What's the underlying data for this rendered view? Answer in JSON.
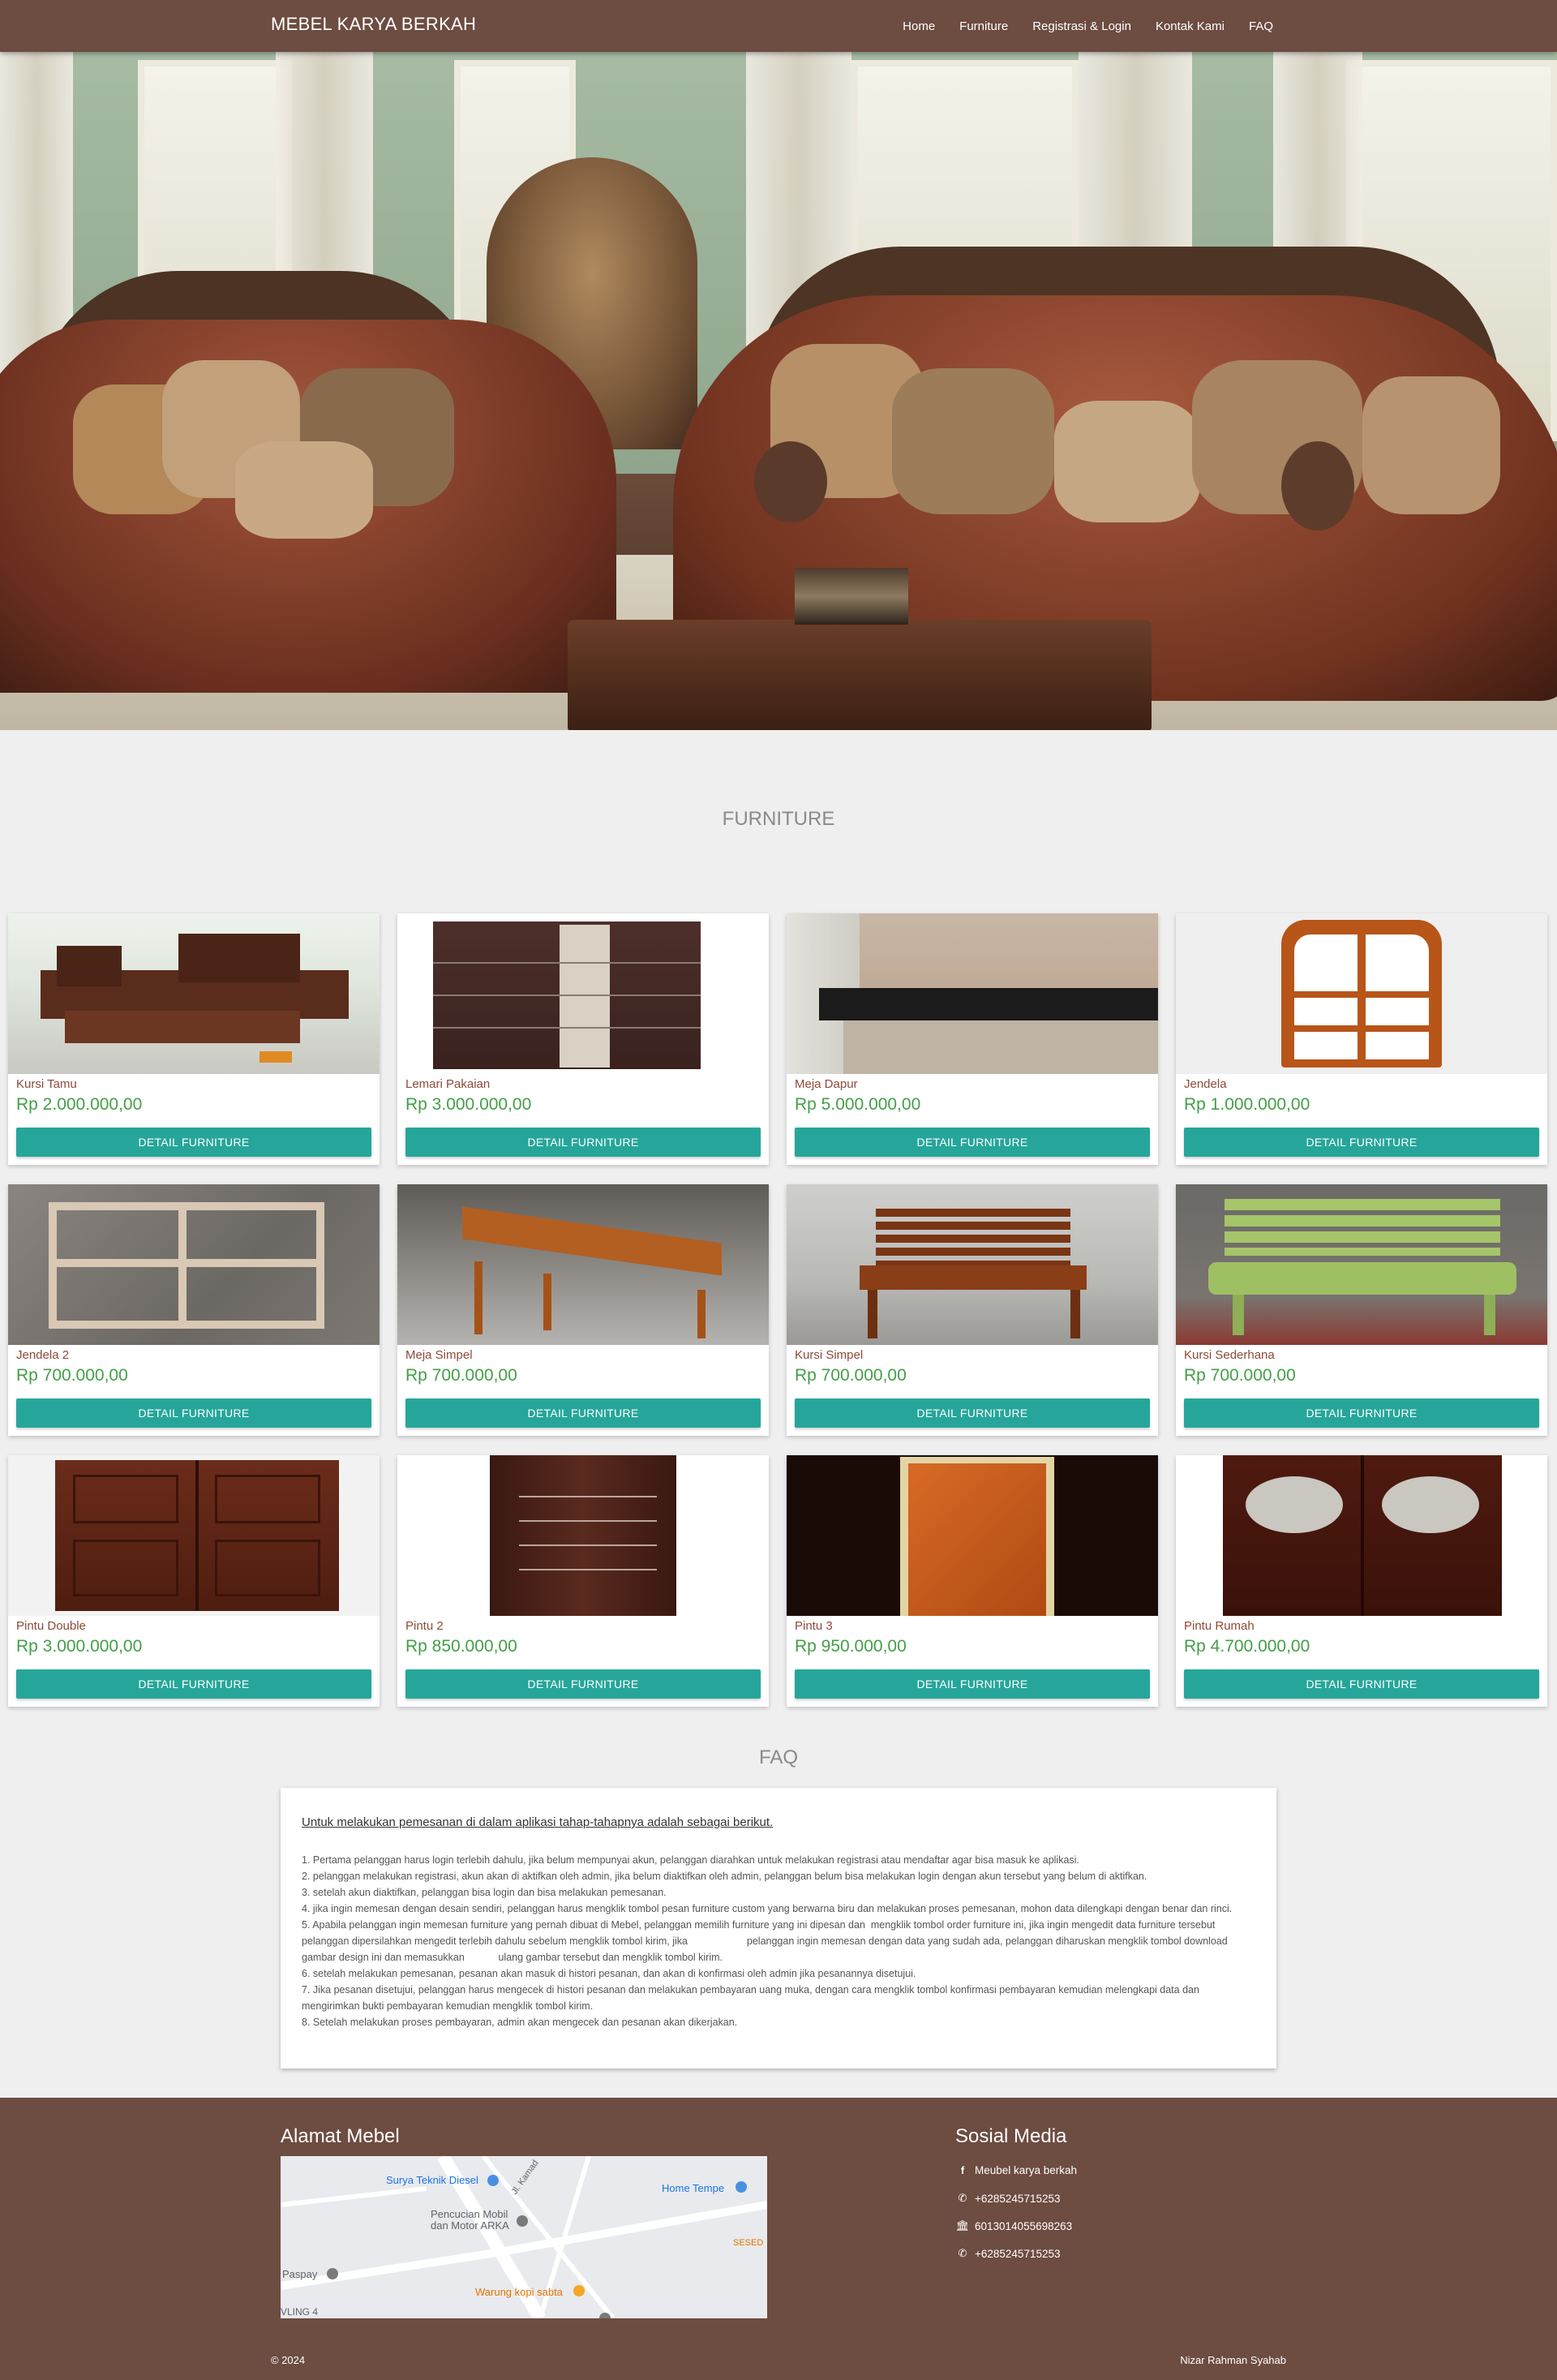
{
  "navbar": {
    "brand": "MEBEL KARYA BERKAH",
    "links": [
      "Home",
      "Furniture",
      "Registrasi & Login",
      "Kontak Kami",
      "FAQ"
    ]
  },
  "furniture": {
    "title": "FURNITURE",
    "button_label": "DETAIL FURNITURE",
    "items": [
      {
        "name": "Kursi Tamu",
        "price": "Rp 2.000.000,00"
      },
      {
        "name": "Lemari Pakaian",
        "price": "Rp 3.000.000,00"
      },
      {
        "name": "Meja Dapur",
        "price": "Rp 5.000.000,00"
      },
      {
        "name": "Jendela",
        "price": "Rp 1.000.000,00"
      },
      {
        "name": "Jendela 2",
        "price": "Rp 700.000,00"
      },
      {
        "name": "Meja Simpel",
        "price": "Rp 700.000,00"
      },
      {
        "name": "Kursi Simpel",
        "price": "Rp 700.000,00"
      },
      {
        "name": "Kursi Sederhana",
        "price": "Rp 700.000,00"
      },
      {
        "name": "Pintu Double",
        "price": "Rp 3.000.000,00"
      },
      {
        "name": "Pintu 2",
        "price": "Rp 850.000,00"
      },
      {
        "name": "Pintu 3",
        "price": "Rp 950.000,00"
      },
      {
        "name": "Pintu Rumah",
        "price": "Rp 4.700.000,00"
      }
    ]
  },
  "faq": {
    "title": "FAQ",
    "heading": "Untuk melakukan pemesanan di dalam aplikasi tahap-tahapnya adalah sebagai berikut.",
    "steps": [
      "1. Pertama pelanggan harus login terlebih dahulu, jika belum mempunyai akun, pelanggan diarahkan untuk melakukan registrasi atau mendaftar agar bisa masuk ke aplikasi.",
      "2. pelanggan melakukan registrasi, akun akan di aktifkan oleh admin, jika belum diaktifkan oleh admin, pelanggan belum bisa melakukan login dengan akun tersebut yang belum di aktifkan.",
      "3. setelah akun diaktifkan, pelanggan bisa login dan bisa melakukan pemesanan.",
      "4. jika ingin memesan dengan desain sendiri, pelanggan harus mengklik tombol pesan furniture custom yang berwarna biru dan melakukan proses pemesanan, mohon data dilengkapi dengan benar dan rinci.",
      "5. Apabila pelanggan ingin memesan furniture yang pernah dibuat di Mebel, pelanggan memilih furniture yang ini dipesan dan  mengklik tombol order furniture ini, jika ingin mengedit data furniture tersebut pelanggan dipersilahkan mengedit terlebih dahulu sebelum mengklik tombol kirim, jika                     pelanggan ingin memesan dengan data yang sudah ada, pelanggan diharuskan mengklik tombol download gambar design ini dan memasukkan            ulang gambar tersebut dan mengklik tombol kirim.",
      "6. setelah melakukan pemesanan, pesanan akan masuk di histori pesanan, dan akan di konfirmasi oleh admin jika pesanannya disetujui.",
      "7. Jika pesanan disetujui, pelanggan harus mengecek di histori pesanan dan melakukan pembayaran uang muka, dengan cara mengklik tombol konfirmasi pembayaran kemudian melengkapi data dan mengirimkan bukti pembayaran kemudian mengklik tombol kirim.",
      "8. Setelah melakukan proses pembayaran, admin akan mengecek dan pesanan akan dikerjakan."
    ]
  },
  "footer": {
    "address_title": "Alamat Mebel",
    "social_title": "Sosial Media",
    "social": [
      {
        "icon": "facebook-icon",
        "glyph": "f",
        "text": "Meubel karya berkah"
      },
      {
        "icon": "whatsapp-icon",
        "glyph": "✆",
        "text": "+6285245715253"
      },
      {
        "icon": "bank-icon",
        "glyph": "🏛",
        "text": "6013014055698263"
      },
      {
        "icon": "phone-icon",
        "glyph": "✆",
        "text": "+6285245715253"
      }
    ],
    "map_labels": {
      "a": "Surya Teknik Diesel",
      "b": "Home Tempe",
      "c": "Pencucian Mobil\ndan Motor ARKA",
      "d": "Paspay",
      "e": "Warung kopi sabta",
      "f": "Jl. Kamad",
      "g": "SESED",
      "h": "VLING 4"
    },
    "copyright": "© 2024",
    "author": "Nizar Rahman Syahab"
  }
}
